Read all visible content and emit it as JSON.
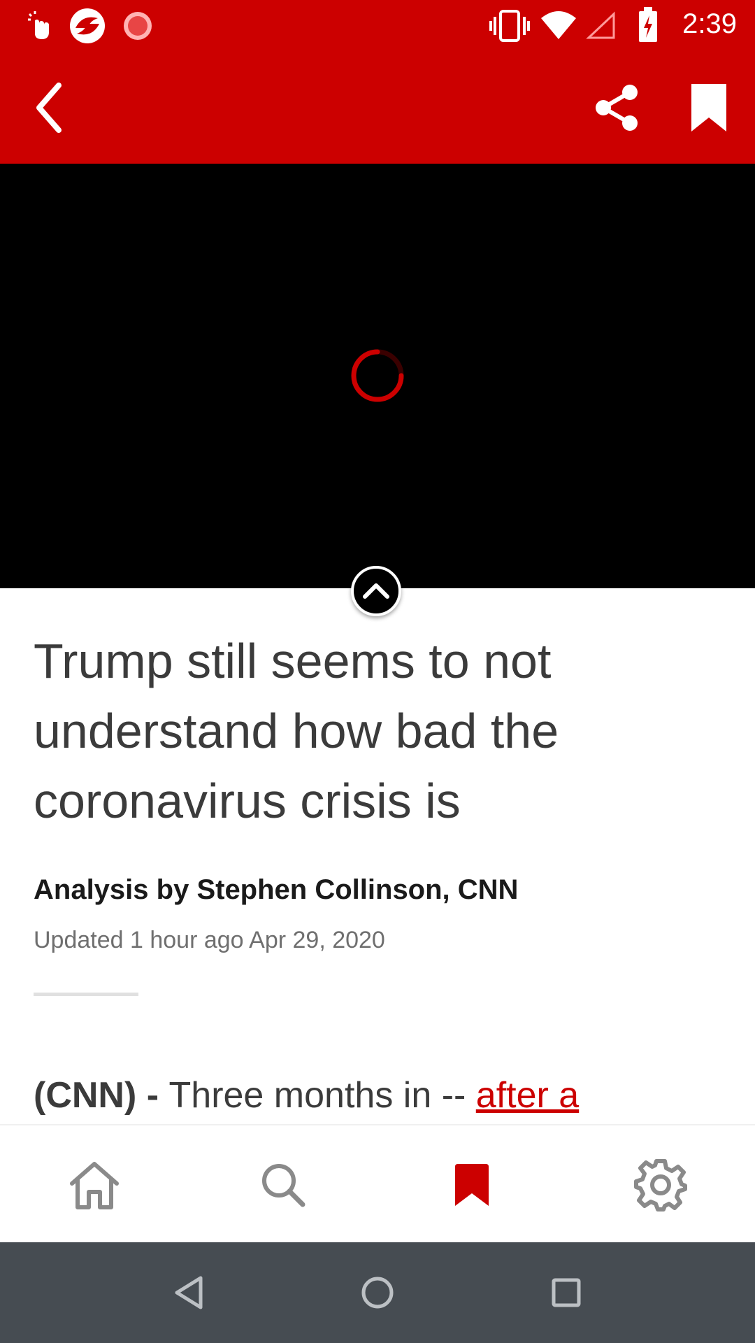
{
  "status_bar": {
    "time": "2:39",
    "icons": [
      "gesture-icon",
      "app-logo-icon",
      "sync-icon",
      "vibrate-icon",
      "wifi-icon",
      "cell-signal-icon",
      "battery-charging-icon"
    ]
  },
  "app_bar": {
    "back_icon": "chevron-left-icon",
    "share_icon": "share-icon",
    "bookmark_icon": "bookmark-icon",
    "background_color": "#cc0000"
  },
  "video": {
    "state": "loading",
    "spinner_color": "#cc0000",
    "collapse_icon": "chevron-up-icon"
  },
  "article": {
    "headline": "Trump still seems to not understand how bad the coronavirus crisis is",
    "byline": "Analysis by Stephen Collinson, CNN",
    "updated": "Updated 1 hour ago Apr 29, 2020",
    "lead_source": "(CNN) - ",
    "lead_text": "Three months in -- ",
    "lead_link": "after a"
  },
  "bottom_nav": {
    "items": [
      {
        "name": "home",
        "icon": "home-icon",
        "active": false
      },
      {
        "name": "search",
        "icon": "search-icon",
        "active": false
      },
      {
        "name": "saved",
        "icon": "bookmark-icon",
        "active": true
      },
      {
        "name": "settings",
        "icon": "gear-icon",
        "active": false
      }
    ],
    "active_color": "#cc0000",
    "inactive_color": "#8a8a8a"
  },
  "system_nav": {
    "icons": [
      "back-triangle-icon",
      "home-circle-icon",
      "recents-square-icon"
    ]
  }
}
